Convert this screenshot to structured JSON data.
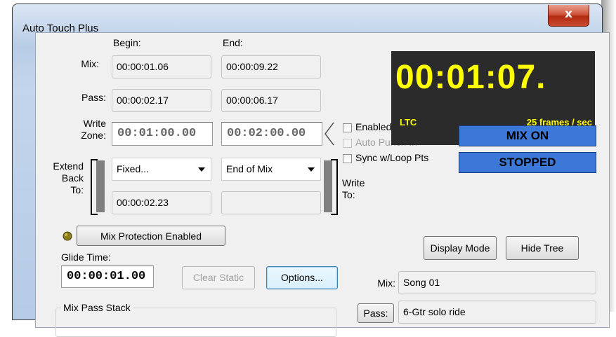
{
  "window": {
    "title": "Auto Touch Plus",
    "close_glyph": "x"
  },
  "headers": {
    "begin": "Begin:",
    "end": "End:"
  },
  "mix": {
    "label": "Mix:",
    "begin": "00:00:01.06",
    "end": "00:00:09.22"
  },
  "pass": {
    "label": "Pass:",
    "begin": "00:00:02.17",
    "end": "00:00:06.17"
  },
  "write_zone": {
    "label_line1": "Write",
    "label_line2": "Zone:",
    "begin": "00:01:00.00",
    "end": "00:02:00.00"
  },
  "extend_back": {
    "label_line1": "Extend",
    "label_line2": "Back",
    "label_line3": "To:",
    "begin_option": "Fixed...",
    "end_option": "End of Mix",
    "begin_time": "00:00:02.23",
    "end_time": ""
  },
  "write_to": {
    "label_line1": "Write",
    "label_line2": "To:"
  },
  "checkboxes": {
    "enabled": {
      "label": "Enabled",
      "checked": false
    },
    "auto_punch_in": {
      "label": "Auto Punch In",
      "checked": false,
      "disabled": true
    },
    "sync_loop": {
      "label": "Sync w/Loop Pts",
      "checked": false
    }
  },
  "clock": {
    "time": "00:01:07.",
    "source": "LTC",
    "rate": "25 frames / sec"
  },
  "status": {
    "mode": "MIX ON",
    "transport": "STOPPED"
  },
  "mix_protection": {
    "label": "Mix Protection Enabled"
  },
  "glide": {
    "label": "Glide Time:",
    "value": "00:00:01.00"
  },
  "buttons": {
    "clear_static": "Clear Static",
    "options": "Options...",
    "display_mode": "Display Mode",
    "hide_tree": "Hide Tree",
    "pass": "Pass:"
  },
  "tree": {
    "mix_label": "Mix:",
    "mix_value": "Song 01",
    "pass_value": "6-Gtr solo ride"
  },
  "stack": {
    "label": "Mix Pass Stack"
  },
  "colors": {
    "clock_bg": "#2b2b2b",
    "clock_text": "#ffff00",
    "status_bg": "#3c78d8",
    "close_red": "#c94a2f"
  }
}
